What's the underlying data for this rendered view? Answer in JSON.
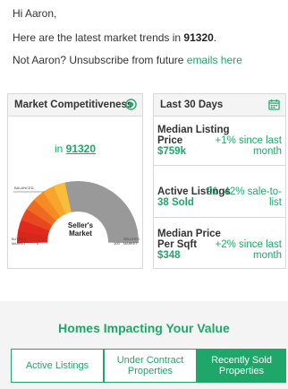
{
  "email": {
    "greeting": "Hi Aaron,",
    "intro_text": "Here are the latest market trends in ",
    "zip": "91320",
    "intro_end": ".",
    "unsub_text": "Not Aaron? Unsubscribe from future ",
    "unsub_link": "emails here"
  },
  "competitiveness": {
    "title": "Market Competitiveness",
    "in_label": "in ",
    "zip": "91320",
    "gauge": {
      "center_label_line1": "Seller's",
      "center_label_line2": "Market",
      "balanced_label": "BALANCED",
      "buyers_line1": "BUYER'S",
      "buyers_line2": "MARKET",
      "sellers_line1": "SELLER'S",
      "sellers_line2": "MARKET",
      "min_tick": "0",
      "max_tick": "100",
      "value_percent": 80
    }
  },
  "last30": {
    "title": "Last 30 Days",
    "rows": [
      {
        "label_line1": "Median Listing",
        "label_line2": "Price",
        "value": "$759k",
        "change_line1": "+1% since last",
        "change_line2": "month"
      },
      {
        "label_line1": "Active Listings",
        "value": "38 Sold",
        "change_line1": "91, 42% sale-to-",
        "change_line2": "list"
      },
      {
        "label_line1": "Median Price",
        "label_line2": "Per Sqft",
        "value": "$348",
        "change_line1": "+2% since last",
        "change_line2": "month"
      }
    ]
  },
  "homes": {
    "title": "Homes Impacting Your Value",
    "tabs": [
      {
        "line1": "Active Listings",
        "line2": ""
      },
      {
        "line1": "Under Contract",
        "line2": "Properties"
      },
      {
        "line1": "Recently Sold",
        "line2": "Properties"
      }
    ]
  },
  "colors": {
    "accent_green": "#1fa76a",
    "panel_bg": "#f4f4f4",
    "border": "#d8d8d8"
  }
}
